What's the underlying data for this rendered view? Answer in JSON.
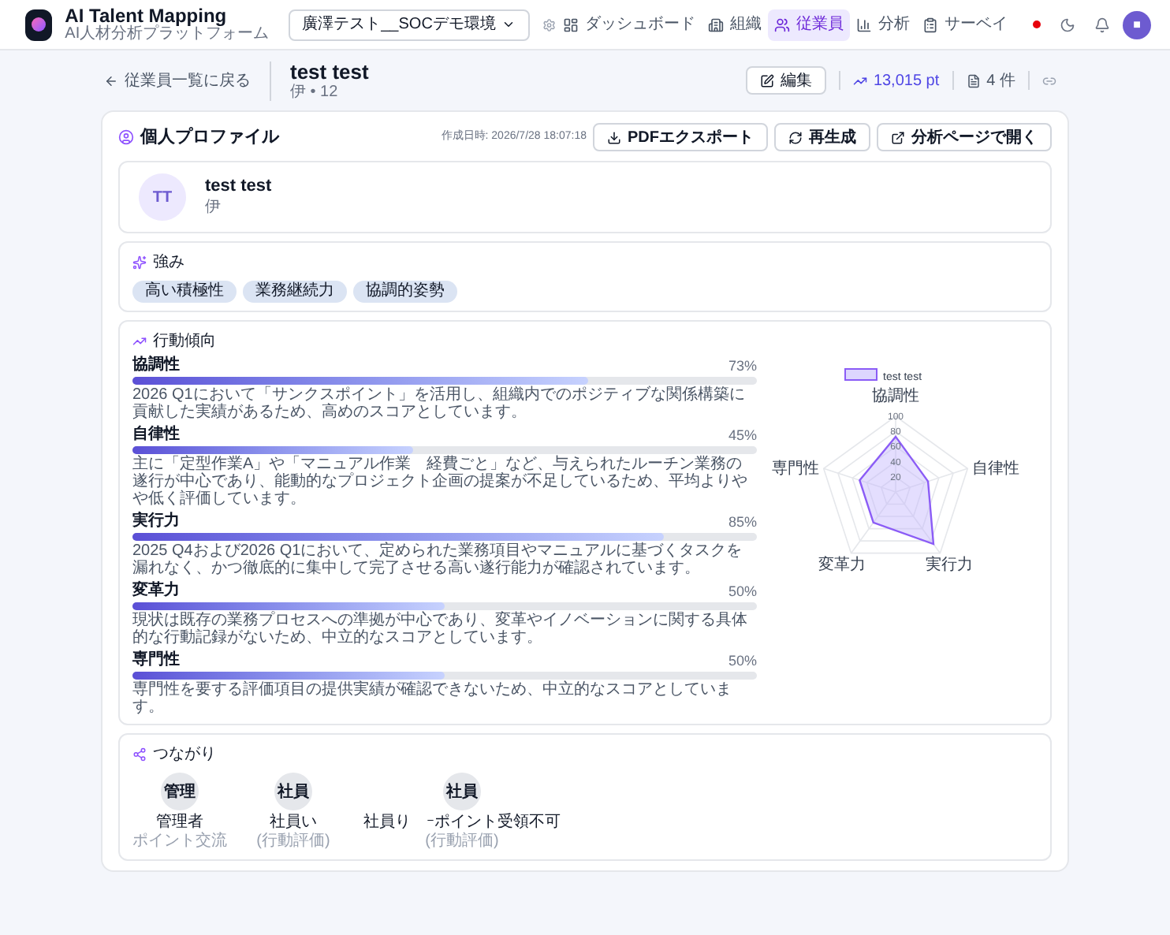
{
  "app": {
    "title": "AI Talent Mapping",
    "subtitle": "AI人材分析プラットフォーム"
  },
  "workspace": {
    "value": "廣澤テスト__SOCデモ環境"
  },
  "nav": [
    {
      "label": "ダッシュボード",
      "selected": false
    },
    {
      "label": "組織",
      "selected": false
    },
    {
      "label": "従業員",
      "selected": true
    },
    {
      "label": "分析",
      "selected": false
    },
    {
      "label": "サーベイ",
      "selected": false
    }
  ],
  "user": {
    "initial": "■"
  },
  "back_link": "従業員一覧に戻る",
  "employee": {
    "name": "test test",
    "meta": "伊 • 12"
  },
  "actions": {
    "edit": "編集",
    "points": "13,015 pt",
    "docs": "4 件"
  },
  "profile": {
    "title": "個人プロファイル",
    "created": "作成日時: 2026/7/28 18:07:18",
    "buttons": [
      "PDFエクスポート",
      "再生成",
      "分析ページで開く"
    ],
    "person": {
      "initials": "TT",
      "name": "test test",
      "sub": "伊"
    }
  },
  "strengths": {
    "title": "強み",
    "tags": [
      "高い積極性",
      "業務継続力",
      "協調的姿勢"
    ]
  },
  "behavior": {
    "title": "行動傾向",
    "traits": [
      {
        "name": "協調性",
        "value": "73%",
        "level": 0.73,
        "description": "2026 Q1において「サンクスポイント」を活用し、組織内でのポジティブな関係構築に貢献した実績があるため、高めのスコアとしています。"
      },
      {
        "name": "自律性",
        "value": "45%",
        "level": 0.45,
        "description": "主に「定型作業A」や「マニュアル作業　経費ごと」など、与えられたルーチン業務の遂行が中心であり、能動的なプロジェクト企画の提案が不足しているため、平均よりやや低く評価しています。"
      },
      {
        "name": "実行力",
        "value": "85%",
        "level": 0.85,
        "description": "2025 Q4および2026 Q1において、定められた業務項目やマニュアルに基づくタスクを漏れなく、かつ徹底的に集中して完了させる高い遂行能力が確認されています。"
      },
      {
        "name": "変革力",
        "value": "50%",
        "level": 0.5,
        "description": "現状は既存の業務プロセスへの準拠が中心であり、変革やイノベーションに関する具体的な行動記録がないため、中立的なスコアとしています。"
      },
      {
        "name": "専門性",
        "value": "50%",
        "level": 0.5,
        "description": "専門性を要する評価項目の提供実績が確認できないため、中立的なスコアとしています。"
      }
    ],
    "radar": {
      "legend": "test test",
      "axes": [
        "協調性",
        "自律性",
        "実行力",
        "変革力",
        "専門性"
      ],
      "ticks": [
        "100",
        "80",
        "60",
        "40",
        "20"
      ]
    }
  },
  "connections": {
    "title": "つながり",
    "nodes": [
      {
        "badge": "管理",
        "name": "管理者",
        "sub": "ポイント交流"
      },
      {
        "badge": "社員",
        "name": "社員い",
        "sub": "(行動評価)"
      },
      {
        "badge": "社員",
        "name": "社員り　ｰポイント受領不可",
        "sub": "(行動評価)"
      }
    ]
  }
}
